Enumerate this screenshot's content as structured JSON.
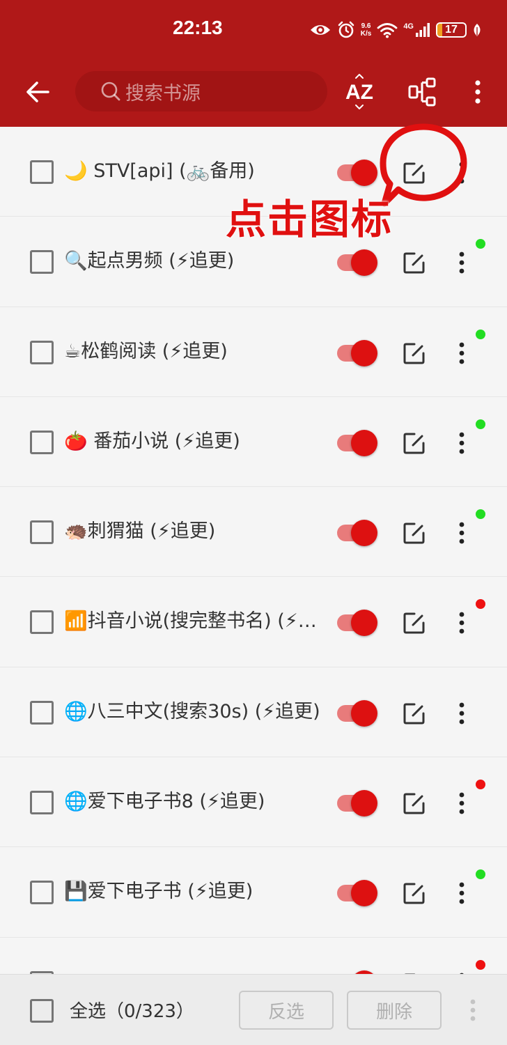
{
  "status_bar": {
    "time": "22:13",
    "net_speed_value": "9.6",
    "net_speed_unit": "K/s",
    "network_type": "4G",
    "battery_level": "17",
    "battery_fraction": 0.17
  },
  "toolbar": {
    "search_placeholder": "搜索书源",
    "sort_label": "AZ",
    "group_icon": "group-icon",
    "more_icon": "more-vertical-icon",
    "back_icon": "arrow-left-icon"
  },
  "colors": {
    "header": "#b01818",
    "search_bg": "#a11414",
    "switch_track": "#e87b7b",
    "switch_knob": "#dd1111",
    "status_ok": "#22dd22",
    "status_error": "#ee1111",
    "annotation": "#e01010"
  },
  "sources": [
    {
      "name": "🌙 STV[api] (🚲备用)",
      "enabled": true,
      "status": "none"
    },
    {
      "name": "🔍起点男频 (⚡追更)",
      "enabled": true,
      "status": "ok"
    },
    {
      "name": "☕松鹤阅读 (⚡追更)",
      "enabled": true,
      "status": "ok"
    },
    {
      "name": "🍅 番茄小说 (⚡追更)",
      "enabled": true,
      "status": "ok"
    },
    {
      "name": "🦔刺猬猫 (⚡追更)",
      "enabled": true,
      "status": "ok"
    },
    {
      "name": "📶抖音小说(搜完整书名) (⚡追更)",
      "enabled": true,
      "status": "error"
    },
    {
      "name": "🌐八三中文(搜索30s) (⚡追更)",
      "enabled": true,
      "status": "none"
    },
    {
      "name": "🌐爱下电子书8 (⚡追更)",
      "enabled": true,
      "status": "error"
    },
    {
      "name": "💾爱下电子书 (⚡追更)",
      "enabled": true,
      "status": "ok"
    },
    {
      "name": "",
      "enabled": true,
      "status": "error"
    }
  ],
  "annotation": {
    "text": "点击图标"
  },
  "bottom_bar": {
    "select_all_label": "全选（0/323）",
    "invert_label": "反选",
    "delete_label": "删除"
  }
}
